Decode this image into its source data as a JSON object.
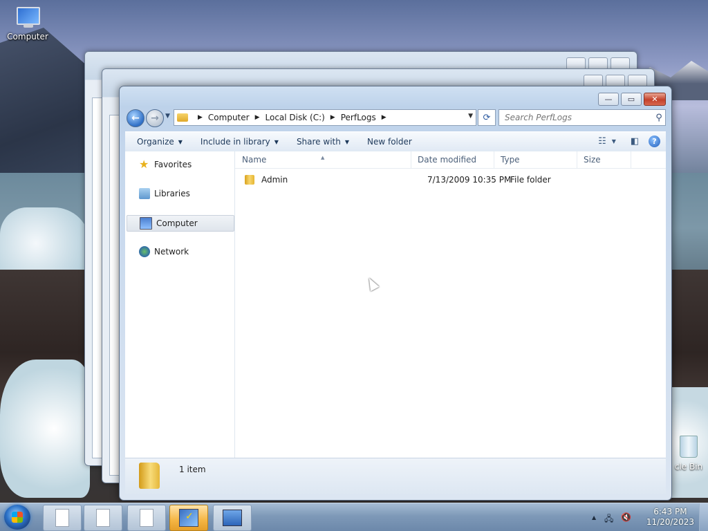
{
  "desktop": {
    "computer_icon_label": "Computer",
    "recycle_bin_label": "cle Bin"
  },
  "window": {
    "nav": {
      "back_glyph": "←",
      "forward_glyph": "→",
      "history_glyph": "▼"
    },
    "address": {
      "crumbs": [
        "Computer",
        "Local Disk (C:)",
        "PerfLogs"
      ],
      "separator": "▶",
      "dropdown_glyph": "▼",
      "refresh_glyph": "⟳"
    },
    "search": {
      "placeholder": "Search PerfLogs",
      "icon_glyph": "⚲"
    },
    "caption_buttons": {
      "minimize": "—",
      "maximize": "▭",
      "close": "✕"
    },
    "toolbar": {
      "organize": "Organize",
      "include_in_library": "Include in library",
      "share_with": "Share with",
      "new_folder": "New folder",
      "dropdown_glyph": "▼",
      "view_glyph": "☷",
      "preview_glyph": "◧",
      "help_glyph": "?"
    },
    "nav_pane": {
      "items": [
        {
          "label": "Favorites",
          "icon": "star-icon"
        },
        {
          "label": "Libraries",
          "icon": "libraries-icon"
        },
        {
          "label": "Computer",
          "icon": "computer-icon",
          "selected": true
        },
        {
          "label": "Network",
          "icon": "network-icon"
        }
      ]
    },
    "columns": {
      "name": "Name",
      "date_modified": "Date modified",
      "type": "Type",
      "size": "Size",
      "sort_glyph": "▲"
    },
    "files": [
      {
        "name": "Admin",
        "date_modified": "7/13/2009 10:35 PM",
        "type": "File folder",
        "size": ""
      }
    ],
    "details": {
      "item_count": "1 item"
    }
  },
  "taskbar": {
    "clock_time": "6:43 PM",
    "clock_date": "11/20/2023",
    "tray_arrow": "▲",
    "tray_network": "🖧",
    "tray_volume": "🔇"
  },
  "colors": {
    "selection": "#dfe5ec",
    "toolbar_text": "#1e395b",
    "close_red": "#c3412b",
    "active_task": "#f5b543"
  }
}
